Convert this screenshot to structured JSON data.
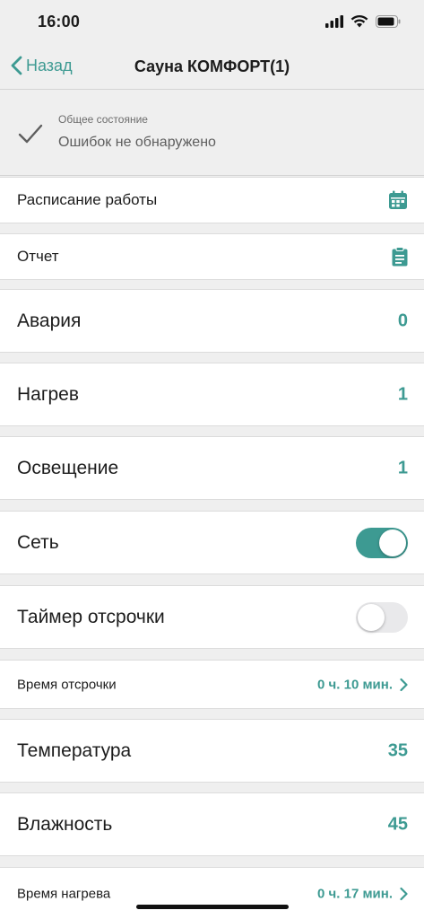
{
  "status_bar": {
    "time": "16:00"
  },
  "nav": {
    "back_label": "Назад",
    "title": "Сауна КОМФОРТ(1)"
  },
  "state": {
    "label": "Общее состояние",
    "value": "Ошибок не обнаружено"
  },
  "rows": {
    "schedule": {
      "label": "Расписание работы",
      "icon": "calendar-icon"
    },
    "report": {
      "label": "Отчет",
      "icon": "clipboard-icon"
    },
    "alarm": {
      "label": "Авария",
      "value": "0"
    },
    "heating": {
      "label": "Нагрев",
      "value": "1"
    },
    "lighting": {
      "label": "Освещение",
      "value": "1"
    },
    "network": {
      "label": "Сеть",
      "on": true
    },
    "delay_timer": {
      "label": "Таймер отсрочки",
      "on": false
    },
    "delay_time": {
      "label": "Время отсрочки",
      "value": "0 ч. 10 мин."
    },
    "temperature": {
      "label": "Температура",
      "value": "35"
    },
    "humidity": {
      "label": "Влажность",
      "value": "45"
    },
    "heating_time": {
      "label": "Время нагрева",
      "value": "0 ч. 17 мин."
    }
  },
  "colors": {
    "accent": "#3d9a92",
    "background": "#efefef",
    "row": "#ffffff"
  }
}
